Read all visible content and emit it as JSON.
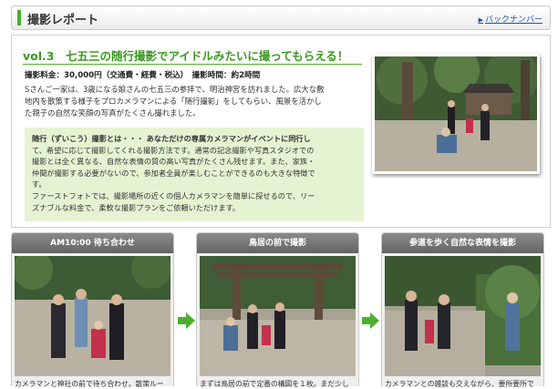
{
  "header": {
    "title": "撮影レポート",
    "back_link": "バックナンバー"
  },
  "report": {
    "heading": "vol.3　七五三の随行撮影でアイドルみたいに撮ってもらえる！",
    "fee_line": "撮影料金：30,000円（交通費・経費・税込）　撮影時間：約2時間",
    "intro": [
      "Sさんご一家は、3歳になる娘さんの七五三の参拝で、明治神宮を訪れました。広大な敷",
      "地内を散策する様子をプロカメラマンによる「随行撮影」をしてもらい、風景を活かし",
      "た親子の自然な笑顔の写真がたくさん撮れました。"
    ],
    "explain": [
      "随行（ずいこう）撮影とは・・・ あなただけの専属カメラマンがイベントに同行し",
      "て、希望に応じて撮影してくれる撮影方法です。通常の記念撮影や写真スタジオでの",
      "撮影とは全く異なる、自然な表情の質の高い写真がたくさん残せます。また、家族・",
      "仲間が撮影する必要がないので、参加者全員が楽しむことができるのも大きな特徴で",
      "す。",
      "ファーストフォトでは、撮影場所の近くの個人カメラマンを簡単に探せるので、リー",
      "ズナブルな料金で、柔軟な撮影プランをご依頼いただけます。"
    ]
  },
  "steps": [
    {
      "title": "AM10:00 待ち合わせ",
      "caption": "カメラマンと神社の前で待ち合わせ。散策ルー"
    },
    {
      "title": "鳥居の前で撮影",
      "caption": "まずは鳥居の前で定番の構図を１枚。まだ少し"
    },
    {
      "title": "参道を歩く自然な表情を撮影",
      "caption": "カメラマンとの雑談も交えながら、要所要所で"
    }
  ],
  "colors": {
    "accent_green": "#4caf30",
    "heading_green": "#3a9a1f",
    "panel_green": "#e6f3d2",
    "link_blue": "#1a55b8"
  }
}
